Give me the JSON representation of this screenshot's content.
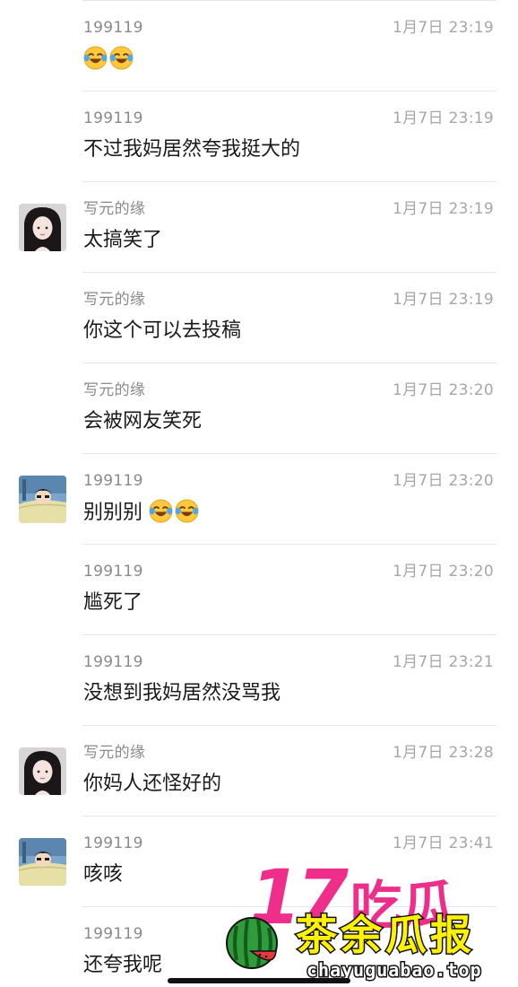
{
  "messages": [
    {
      "sender": "199119",
      "time": "1月7日 23:19",
      "text": "",
      "emojis": [
        "laugh-cry-emoji",
        "laugh-cry-emoji"
      ],
      "avatar": null
    },
    {
      "sender": "199119",
      "time": "1月7日 23:19",
      "text": "不过我妈居然夸我挺大的",
      "emojis": [],
      "avatar": null
    },
    {
      "sender": "写元的缘",
      "time": "1月7日 23:19",
      "text": "太搞笑了",
      "emojis": [],
      "avatar": "girl-avatar"
    },
    {
      "sender": "写元的缘",
      "time": "1月7日 23:19",
      "text": "你这个可以去投稿",
      "emojis": [],
      "avatar": null
    },
    {
      "sender": "写元的缘",
      "time": "1月7日 23:20",
      "text": "会被网友笑死",
      "emojis": [],
      "avatar": null
    },
    {
      "sender": "199119",
      "time": "1月7日 23:20",
      "text": "别别别",
      "emojis": [
        "laugh-cry-emoji",
        "laugh-cry-emoji"
      ],
      "avatar": "cartoon-avatar"
    },
    {
      "sender": "199119",
      "time": "1月7日 23:20",
      "text": "尴死了",
      "emojis": [],
      "avatar": null
    },
    {
      "sender": "199119",
      "time": "1月7日 23:21",
      "text": "没想到我妈居然没骂我",
      "emojis": [],
      "avatar": null
    },
    {
      "sender": "写元的缘",
      "time": "1月7日 23:28",
      "text": "你妈人还怪好的",
      "emojis": [],
      "avatar": "girl-avatar"
    },
    {
      "sender": "199119",
      "time": "1月7日 23:41",
      "text": "咳咳",
      "emojis": [],
      "avatar": "cartoon-avatar"
    },
    {
      "sender": "199119",
      "time": "",
      "text": "还夸我呢",
      "emojis": [],
      "avatar": null
    }
  ],
  "watermark": {
    "number": "17",
    "word": "吃瓜",
    "title": "茶余瓜报",
    "url": "chayuguabao.top"
  },
  "colors": {
    "sender": "#8a8a8a",
    "time": "#a6a6a6",
    "text": "#1a1a1a",
    "divider": "#e5e5e5",
    "watermark_pink": "#ee2e8a",
    "watermark_yellow": "#fff200"
  }
}
